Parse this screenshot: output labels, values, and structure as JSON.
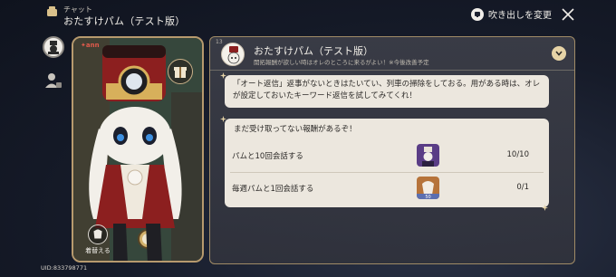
{
  "header": {
    "section_label": "チャット",
    "title": "おたすけパム（テスト版）",
    "switch_bubble_label": "吹き出しを変更"
  },
  "character_card": {
    "brand": "✦ann",
    "change_label": "着替える"
  },
  "uid": "UID:833798771",
  "chat": {
    "thread_number": "13",
    "name": "おたすけパム（テスト版）",
    "signature": "開拓報酬が欲しい時はオレのところに来るがよい！※今後改善予定",
    "messages": [
      "「オート返信」返事がないときはたいてい、列車の掃除をしておる。用がある時は、オレが設定しておいたキーワード返信を試してみてくれ！"
    ],
    "rewards_card": {
      "heading": "まだ受け取ってない報酬があるぞ！",
      "items": [
        {
          "label": "パムと10回会話する",
          "count": "10/10"
        },
        {
          "label": "毎週パムと1回会話する",
          "count": "0/1",
          "thumb_badge": "50"
        }
      ]
    }
  },
  "colors": {
    "panel_border": "#a08b66",
    "bubble_bg": "#ece7de",
    "accent_gold": "#e6d3a6"
  }
}
